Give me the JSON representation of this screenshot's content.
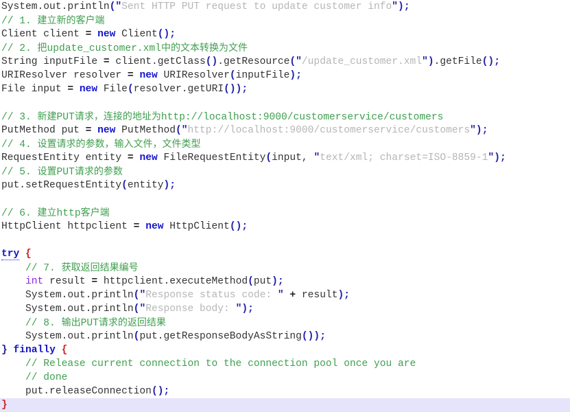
{
  "editor": {
    "name": "java-code-viewer",
    "language": "Java",
    "background_color": "#ffffff",
    "current_line_highlight_color": "#e6e4fa",
    "colors": {
      "plain": "#333333",
      "comment": "#3f9f4f",
      "string": "#b6b6b6",
      "keyword": "#1414cc",
      "type": "#8a2be2",
      "punctuation": "#2222aa",
      "brace_red": "#cc2222"
    }
  },
  "lines": [
    {
      "n": 1,
      "highlight": false,
      "tokens": [
        {
          "c": "plain",
          "t": "System.out.println"
        },
        {
          "c": "punct",
          "t": "("
        },
        {
          "c": "punct",
          "t": "\""
        },
        {
          "c": "string",
          "t": "Sent HTTP PUT request to update customer info"
        },
        {
          "c": "punct",
          "t": "\""
        },
        {
          "c": "punct",
          "t": ")"
        },
        {
          "c": "punct",
          "t": ";"
        }
      ]
    },
    {
      "n": 2,
      "highlight": false,
      "tokens": [
        {
          "c": "comment",
          "t": "// 1. "
        },
        {
          "c": "comment cjk",
          "t": "建立新的客户端"
        }
      ]
    },
    {
      "n": 3,
      "highlight": false,
      "tokens": [
        {
          "c": "plain",
          "t": "Client client "
        },
        {
          "c": "op",
          "t": "="
        },
        {
          "c": "plain",
          "t": " "
        },
        {
          "c": "keyword",
          "t": "new"
        },
        {
          "c": "plain",
          "t": " Client"
        },
        {
          "c": "punct",
          "t": "()"
        },
        {
          "c": "punct",
          "t": ";"
        }
      ]
    },
    {
      "n": 4,
      "highlight": false,
      "tokens": [
        {
          "c": "comment",
          "t": "// 2. "
        },
        {
          "c": "comment cjk",
          "t": "把"
        },
        {
          "c": "comment",
          "t": "update_customer.xml"
        },
        {
          "c": "comment cjk",
          "t": "中的文本转换为文件"
        }
      ]
    },
    {
      "n": 5,
      "highlight": false,
      "tokens": [
        {
          "c": "plain",
          "t": "String inputFile "
        },
        {
          "c": "op",
          "t": "="
        },
        {
          "c": "plain",
          "t": " client.getClass"
        },
        {
          "c": "punct",
          "t": "()"
        },
        {
          "c": "plain",
          "t": ".getResource"
        },
        {
          "c": "punct",
          "t": "("
        },
        {
          "c": "punct",
          "t": "\""
        },
        {
          "c": "string",
          "t": "/update_customer.xml"
        },
        {
          "c": "punct",
          "t": "\""
        },
        {
          "c": "punct",
          "t": ")"
        },
        {
          "c": "plain",
          "t": ".getFile"
        },
        {
          "c": "punct",
          "t": "()"
        },
        {
          "c": "punct",
          "t": ";"
        }
      ]
    },
    {
      "n": 6,
      "highlight": false,
      "tokens": [
        {
          "c": "plain",
          "t": "URIResolver resolver "
        },
        {
          "c": "op",
          "t": "="
        },
        {
          "c": "plain",
          "t": " "
        },
        {
          "c": "keyword",
          "t": "new"
        },
        {
          "c": "plain",
          "t": " URIResolver"
        },
        {
          "c": "punct",
          "t": "("
        },
        {
          "c": "plain",
          "t": "inputFile"
        },
        {
          "c": "punct",
          "t": ")"
        },
        {
          "c": "punct",
          "t": ";"
        }
      ]
    },
    {
      "n": 7,
      "highlight": false,
      "tokens": [
        {
          "c": "plain",
          "t": "File input "
        },
        {
          "c": "op",
          "t": "="
        },
        {
          "c": "plain",
          "t": " "
        },
        {
          "c": "keyword",
          "t": "new"
        },
        {
          "c": "plain",
          "t": " File"
        },
        {
          "c": "punct",
          "t": "("
        },
        {
          "c": "plain",
          "t": "resolver.getURI"
        },
        {
          "c": "punct",
          "t": "()"
        },
        {
          "c": "punct",
          "t": ")"
        },
        {
          "c": "punct",
          "t": ";"
        }
      ]
    },
    {
      "n": 8,
      "highlight": false,
      "tokens": []
    },
    {
      "n": 9,
      "highlight": false,
      "tokens": [
        {
          "c": "comment",
          "t": "// 3. "
        },
        {
          "c": "comment cjk",
          "t": "新建"
        },
        {
          "c": "comment",
          "t": "PUT"
        },
        {
          "c": "comment cjk",
          "t": "请求，连接的地址为"
        },
        {
          "c": "comment",
          "t": "http://localhost:9000/customerservice/customers"
        }
      ]
    },
    {
      "n": 10,
      "highlight": false,
      "tokens": [
        {
          "c": "plain",
          "t": "PutMethod put "
        },
        {
          "c": "op",
          "t": "="
        },
        {
          "c": "plain",
          "t": " "
        },
        {
          "c": "keyword",
          "t": "new"
        },
        {
          "c": "plain",
          "t": " PutMethod"
        },
        {
          "c": "punct",
          "t": "("
        },
        {
          "c": "punct",
          "t": "\""
        },
        {
          "c": "string",
          "t": "http://localhost:9000/customerservice/customers"
        },
        {
          "c": "punct",
          "t": "\""
        },
        {
          "c": "punct",
          "t": ")"
        },
        {
          "c": "punct",
          "t": ";"
        }
      ]
    },
    {
      "n": 11,
      "highlight": false,
      "tokens": [
        {
          "c": "comment",
          "t": "// 4. "
        },
        {
          "c": "comment cjk",
          "t": "设置请求的参数，输入文件，文件类型"
        }
      ]
    },
    {
      "n": 12,
      "highlight": false,
      "tokens": [
        {
          "c": "plain",
          "t": "RequestEntity entity "
        },
        {
          "c": "op",
          "t": "="
        },
        {
          "c": "plain",
          "t": " "
        },
        {
          "c": "keyword",
          "t": "new"
        },
        {
          "c": "plain",
          "t": " FileRequestEntity"
        },
        {
          "c": "punct",
          "t": "("
        },
        {
          "c": "plain",
          "t": "input, "
        },
        {
          "c": "punct",
          "t": "\""
        },
        {
          "c": "string",
          "t": "text/xml; charset=ISO-8859-1"
        },
        {
          "c": "punct",
          "t": "\""
        },
        {
          "c": "punct",
          "t": ")"
        },
        {
          "c": "punct",
          "t": ";"
        }
      ]
    },
    {
      "n": 13,
      "highlight": false,
      "tokens": [
        {
          "c": "comment",
          "t": "// 5. "
        },
        {
          "c": "comment cjk",
          "t": "设置"
        },
        {
          "c": "comment",
          "t": "PUT"
        },
        {
          "c": "comment cjk",
          "t": "请求的参数"
        }
      ]
    },
    {
      "n": 14,
      "highlight": false,
      "tokens": [
        {
          "c": "plain",
          "t": "put.setRequestEntity"
        },
        {
          "c": "punct",
          "t": "("
        },
        {
          "c": "plain",
          "t": "entity"
        },
        {
          "c": "punct",
          "t": ")"
        },
        {
          "c": "punct",
          "t": ";"
        }
      ]
    },
    {
      "n": 15,
      "highlight": false,
      "tokens": []
    },
    {
      "n": 16,
      "highlight": false,
      "tokens": [
        {
          "c": "comment",
          "t": "// 6. "
        },
        {
          "c": "comment cjk",
          "t": "建立"
        },
        {
          "c": "comment",
          "t": "http"
        },
        {
          "c": "comment cjk",
          "t": "客户端"
        }
      ]
    },
    {
      "n": 17,
      "highlight": false,
      "tokens": [
        {
          "c": "plain",
          "t": "HttpClient httpclient "
        },
        {
          "c": "op",
          "t": "="
        },
        {
          "c": "plain",
          "t": " "
        },
        {
          "c": "keyword",
          "t": "new"
        },
        {
          "c": "plain",
          "t": " HttpClient"
        },
        {
          "c": "punct",
          "t": "()"
        },
        {
          "c": "punct",
          "t": ";"
        }
      ]
    },
    {
      "n": 18,
      "highlight": false,
      "tokens": []
    },
    {
      "n": 19,
      "highlight": false,
      "tokens": [
        {
          "c": "spell",
          "t": "try"
        },
        {
          "c": "plain",
          "t": " "
        },
        {
          "c": "red",
          "t": "{"
        }
      ]
    },
    {
      "n": 20,
      "highlight": false,
      "tokens": [
        {
          "c": "comment",
          "t": "    // 7. "
        },
        {
          "c": "comment cjk",
          "t": "获取返回结果编号"
        }
      ]
    },
    {
      "n": 21,
      "highlight": false,
      "tokens": [
        {
          "c": "plain",
          "t": "    "
        },
        {
          "c": "type",
          "t": "int"
        },
        {
          "c": "plain",
          "t": " result "
        },
        {
          "c": "op",
          "t": "="
        },
        {
          "c": "plain",
          "t": " httpclient.executeMethod"
        },
        {
          "c": "punct",
          "t": "("
        },
        {
          "c": "plain",
          "t": "put"
        },
        {
          "c": "punct",
          "t": ")"
        },
        {
          "c": "punct",
          "t": ";"
        }
      ]
    },
    {
      "n": 22,
      "highlight": false,
      "tokens": [
        {
          "c": "plain",
          "t": "    System.out.println"
        },
        {
          "c": "punct",
          "t": "("
        },
        {
          "c": "punct",
          "t": "\""
        },
        {
          "c": "string",
          "t": "Response status code: "
        },
        {
          "c": "punct",
          "t": "\""
        },
        {
          "c": "plain",
          "t": " "
        },
        {
          "c": "op",
          "t": "+"
        },
        {
          "c": "plain",
          "t": " result"
        },
        {
          "c": "punct",
          "t": ")"
        },
        {
          "c": "punct",
          "t": ";"
        }
      ]
    },
    {
      "n": 23,
      "highlight": false,
      "tokens": [
        {
          "c": "plain",
          "t": "    System.out.println"
        },
        {
          "c": "punct",
          "t": "("
        },
        {
          "c": "punct",
          "t": "\""
        },
        {
          "c": "string",
          "t": "Response body: "
        },
        {
          "c": "punct",
          "t": "\""
        },
        {
          "c": "punct",
          "t": ")"
        },
        {
          "c": "punct",
          "t": ";"
        }
      ]
    },
    {
      "n": 24,
      "highlight": false,
      "tokens": [
        {
          "c": "comment",
          "t": "    // 8. "
        },
        {
          "c": "comment cjk",
          "t": "输出"
        },
        {
          "c": "comment",
          "t": "PUT"
        },
        {
          "c": "comment cjk",
          "t": "请求的返回结果"
        }
      ]
    },
    {
      "n": 25,
      "highlight": false,
      "tokens": [
        {
          "c": "plain",
          "t": "    System.out.println"
        },
        {
          "c": "punct",
          "t": "("
        },
        {
          "c": "plain",
          "t": "put.getResponseBodyAsString"
        },
        {
          "c": "punct",
          "t": "()"
        },
        {
          "c": "punct",
          "t": ")"
        },
        {
          "c": "punct",
          "t": ";"
        }
      ]
    },
    {
      "n": 26,
      "highlight": false,
      "tokens": [
        {
          "c": "navy",
          "t": "}"
        },
        {
          "c": "plain",
          "t": " "
        },
        {
          "c": "keyword",
          "t": "finally"
        },
        {
          "c": "plain",
          "t": " "
        },
        {
          "c": "red",
          "t": "{"
        }
      ]
    },
    {
      "n": 27,
      "highlight": false,
      "tokens": [
        {
          "c": "comment",
          "t": "    // Release current connection to the connection pool once you are"
        }
      ]
    },
    {
      "n": 28,
      "highlight": false,
      "tokens": [
        {
          "c": "comment",
          "t": "    // done"
        }
      ]
    },
    {
      "n": 29,
      "highlight": false,
      "tokens": [
        {
          "c": "plain",
          "t": "    put.releaseConnection"
        },
        {
          "c": "punct",
          "t": "()"
        },
        {
          "c": "punct",
          "t": ";"
        }
      ]
    },
    {
      "n": 30,
      "highlight": true,
      "tokens": [
        {
          "c": "red",
          "t": "}"
        }
      ]
    }
  ]
}
